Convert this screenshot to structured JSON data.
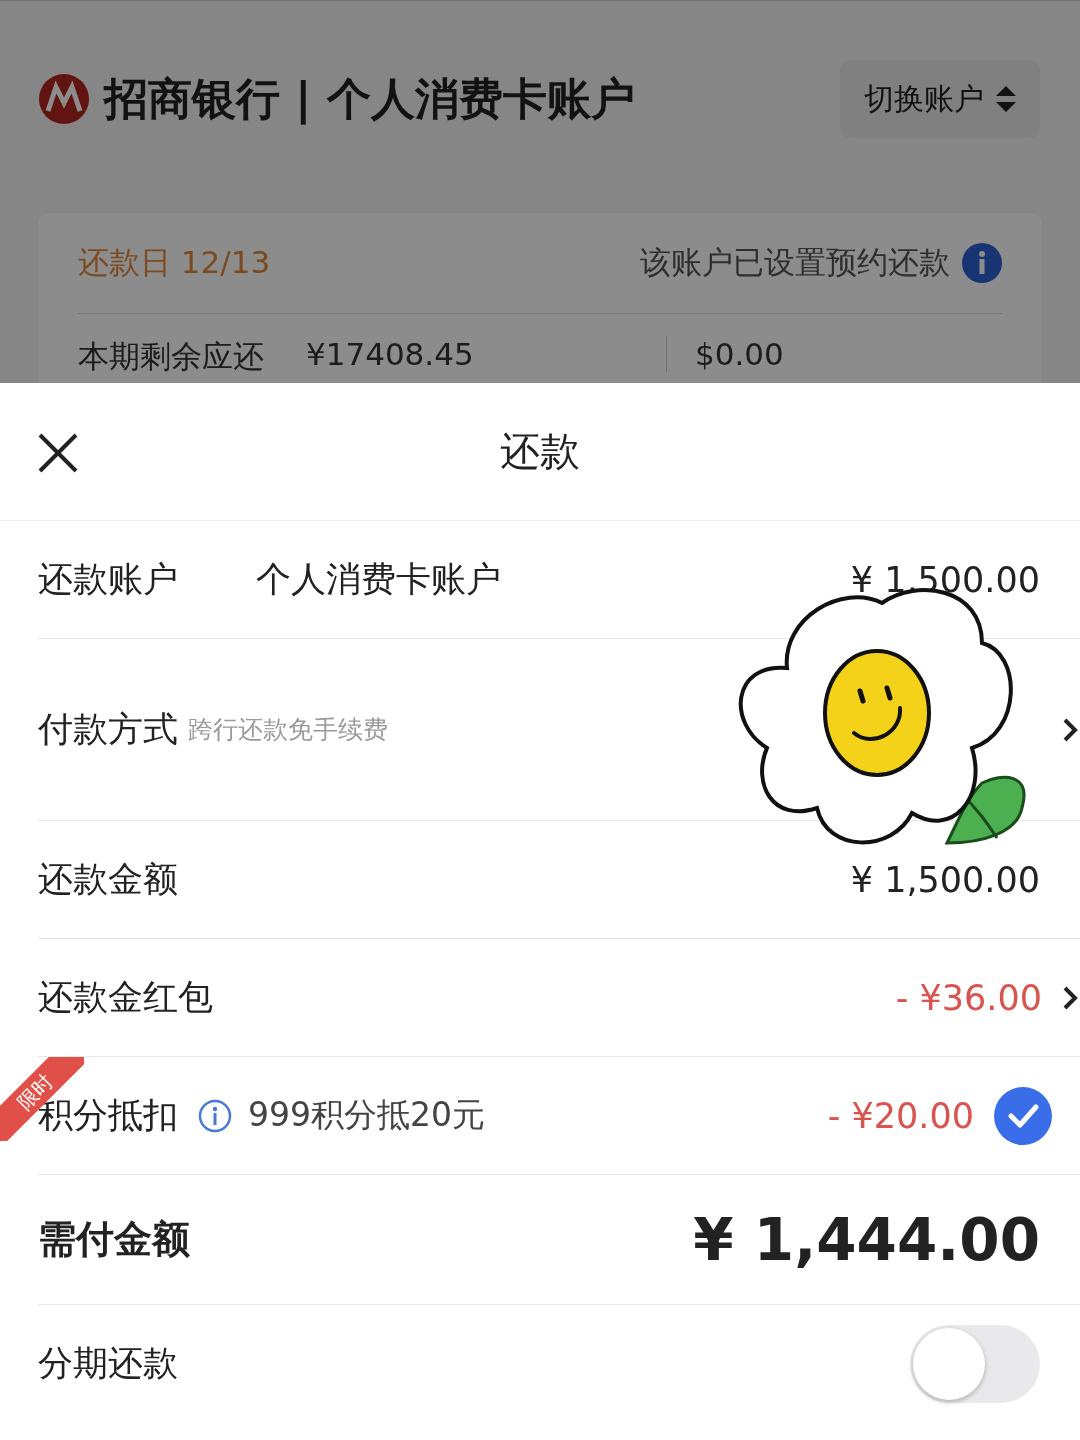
{
  "background": {
    "bank_name": "招商银行 | 个人消费卡账户",
    "switch_button": "切换账户",
    "due_date": "还款日 12/13",
    "autopay_note": "该账户已设置预约还款",
    "remaining_label": "本期剩余应还",
    "remaining_amount": "¥17408.45",
    "usd_amount": "$0.00"
  },
  "sheet": {
    "title": "还款",
    "rows": [
      {
        "kind": "account",
        "label": "还款账户",
        "account": "个人消费卡账户",
        "value": "¥ 1,500.00"
      },
      {
        "kind": "method",
        "label": "付款方式",
        "hint": "跨行还款免手续费"
      },
      {
        "kind": "amount",
        "label": "还款金额",
        "value": "¥ 1,500.00"
      },
      {
        "kind": "coupon",
        "label": "还款金红包",
        "value": "- ¥36.00"
      },
      {
        "kind": "points",
        "badge": "限时",
        "label": "积分抵扣",
        "hint": "999积分抵20元",
        "value": "- ¥20.00",
        "checked": true
      },
      {
        "kind": "total",
        "label": "需付金额",
        "value": "¥ 1,444.00"
      },
      {
        "kind": "toggle",
        "label": "分期还款",
        "on": false
      }
    ]
  }
}
